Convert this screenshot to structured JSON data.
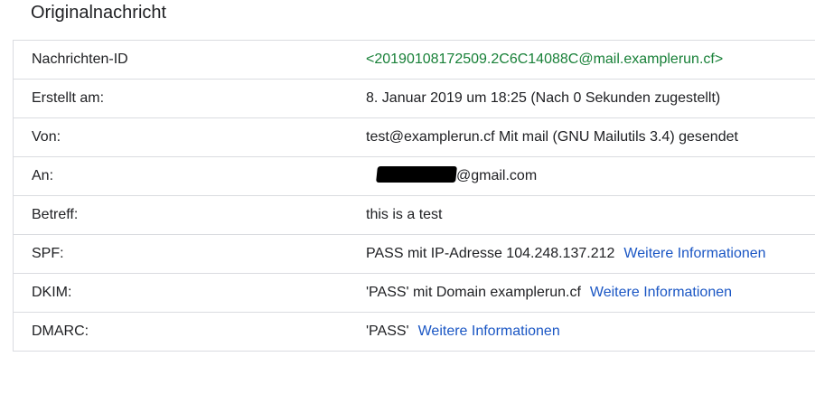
{
  "header": {
    "title": "Originalnachricht"
  },
  "rows": [
    {
      "label": "Nachrichten-ID",
      "value": "<20190108172509.2C6C14088C@mail.examplerun.cf>"
    },
    {
      "label": "Erstellt am:",
      "value": "8. Januar 2019 um 18:25 (Nach 0 Sekunden zugestellt)"
    },
    {
      "label": "Von:",
      "value": "test@examplerun.cf Mit mail (GNU Mailutils 3.4) gesendet"
    },
    {
      "label": "An:",
      "value": "@gmail.com"
    },
    {
      "label": "Betreff:",
      "value": "this is a test"
    },
    {
      "label": "SPF:",
      "value": "PASS mit IP-Adresse 104.248.137.212",
      "link": "Weitere Informationen"
    },
    {
      "label": "DKIM:",
      "value": "'PASS' mit Domain examplerun.cf",
      "link": "Weitere Informationen"
    },
    {
      "label": "DMARC:",
      "value": "'PASS'",
      "link": "Weitere Informationen"
    }
  ],
  "colors": {
    "message_id": "#188038",
    "link": "#1a56c4",
    "border": "#dadce0"
  }
}
